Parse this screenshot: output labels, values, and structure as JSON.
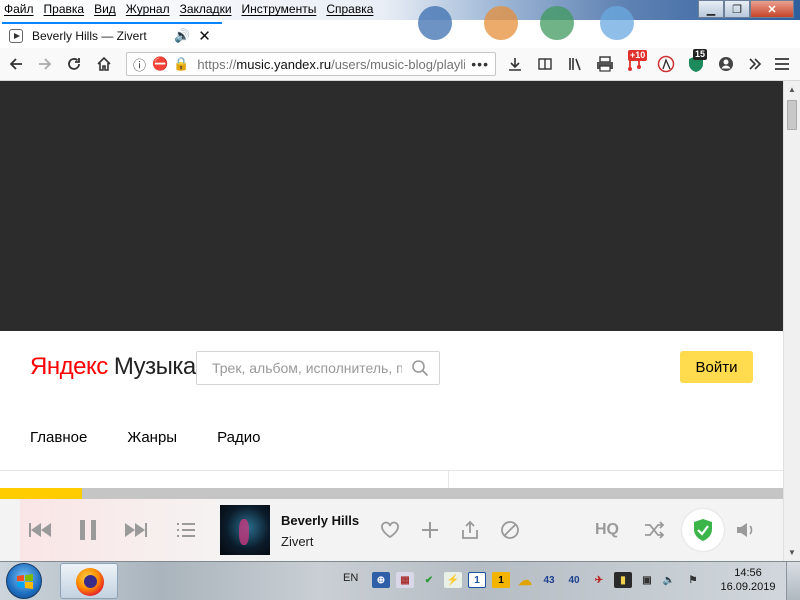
{
  "menu": [
    "Файл",
    "Правка",
    "Вид",
    "Журнал",
    "Закладки",
    "Инструменты",
    "Справка"
  ],
  "window_controls": {
    "minimize": "▁",
    "restore": "❐",
    "close": "✕"
  },
  "tab": {
    "title": "Beverly Hills — Zivert",
    "close": "✕",
    "new_tab": "+"
  },
  "nav": {
    "url_gray_prefix": "https://",
    "url_domain": "music.yandex.ru",
    "url_path": "/users/music-blog/playlists",
    "more": "•••",
    "badge_red": "+10",
    "badge_green": "15"
  },
  "site": {
    "logo_brand": "Яндекс",
    "logo_product": "Музыка",
    "search_placeholder": "Трек, альбом, исполнитель, подкаст",
    "login_label": "Войти",
    "nav_items": [
      "Главное",
      "Жанры",
      "Радио"
    ]
  },
  "player": {
    "progress": 0.105,
    "track_title": "Beverly Hills",
    "artist": "Zivert",
    "hq_label": "HQ"
  },
  "taskbar": {
    "lang": "EN",
    "tray_numbers": [
      "1",
      "1",
      "43",
      "40"
    ],
    "time": "14:56",
    "date": "16.09.2019"
  },
  "colors": {
    "accent_yellow": "#ffdb4d",
    "progress_yellow": "#ffcc00",
    "brand_red": "#ff0000",
    "firefox_blue": "#0a84ff",
    "shield_green": "#3bb54a"
  }
}
